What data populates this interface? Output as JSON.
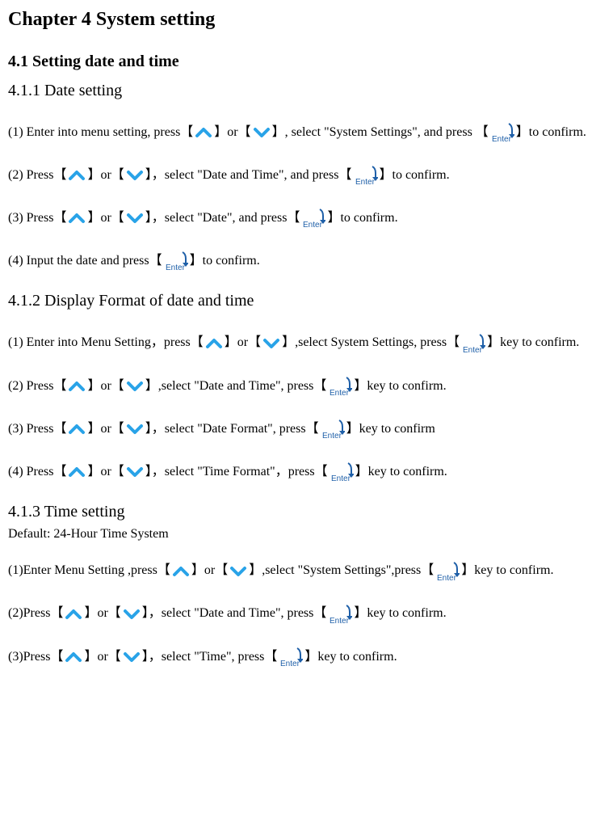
{
  "chapter_title": "Chapter 4 System setting",
  "section_4_1": {
    "title": "4.1 Setting date and time",
    "sub_4_1_1": {
      "title": "4.1.1 Date setting",
      "step1_a": "(1) Enter into menu setting, press【",
      "step1_b": "】or【",
      "step1_c": "】, select \"System Settings\", and press 【",
      "step1_d": "】to confirm.",
      "step2_a": "(2) Press【",
      "step2_b": "】or【",
      "step2_c": "】，select \"Date and Time\", and press【",
      "step2_d": "】to confirm.",
      "step3_a": "(3) Press【",
      "step3_b": "】or【",
      "step3_c": "】，select \"Date\", and press【",
      "step3_d": "】to confirm.",
      "step4_a": "(4) Input the date and press【",
      "step4_b": "】to confirm."
    },
    "sub_4_1_2": {
      "title": "4.1.2 Display Format of date and time",
      "step1_a": "(1) Enter into Menu Setting，press【",
      "step1_b": "】or【",
      "step1_c": "】,select System Settings, press【",
      "step1_d": "】key to confirm.",
      "step2_a": "(2) Press【",
      "step2_b": "】or【",
      "step2_c": "】,select \"Date and Time\", press【",
      "step2_d": "】key to confirm.",
      "step3_a": "(3) Press【",
      "step3_b": "】or【",
      "step3_c": "】，select \"Date Format\", press【",
      "step3_d": "】key to confirm",
      "step4_a": "(4) Press【",
      "step4_b": "】or【",
      "step4_c": "】，select \"Time Format\"，press【",
      "step4_d": "】key to confirm."
    },
    "sub_4_1_3": {
      "title": "4.1.3 Time setting",
      "default": "Default: 24-Hour Time System",
      "step1_a": "(1)Enter Menu Setting ,press【",
      "step1_b": "】or【",
      "step1_c": "】,select \"System Settings\",press【",
      "step1_d": "】key to confirm.",
      "step2_a": "(2)Press【",
      "step2_b": "】or【",
      "step2_c": "】，select \"Date and Time\", press【",
      "step2_d": "】key to confirm.",
      "step3_a": "(3)Press【",
      "step3_b": "】or【",
      "step3_c": "】，select \"Time\", press【",
      "step3_d": "】key to confirm."
    }
  }
}
